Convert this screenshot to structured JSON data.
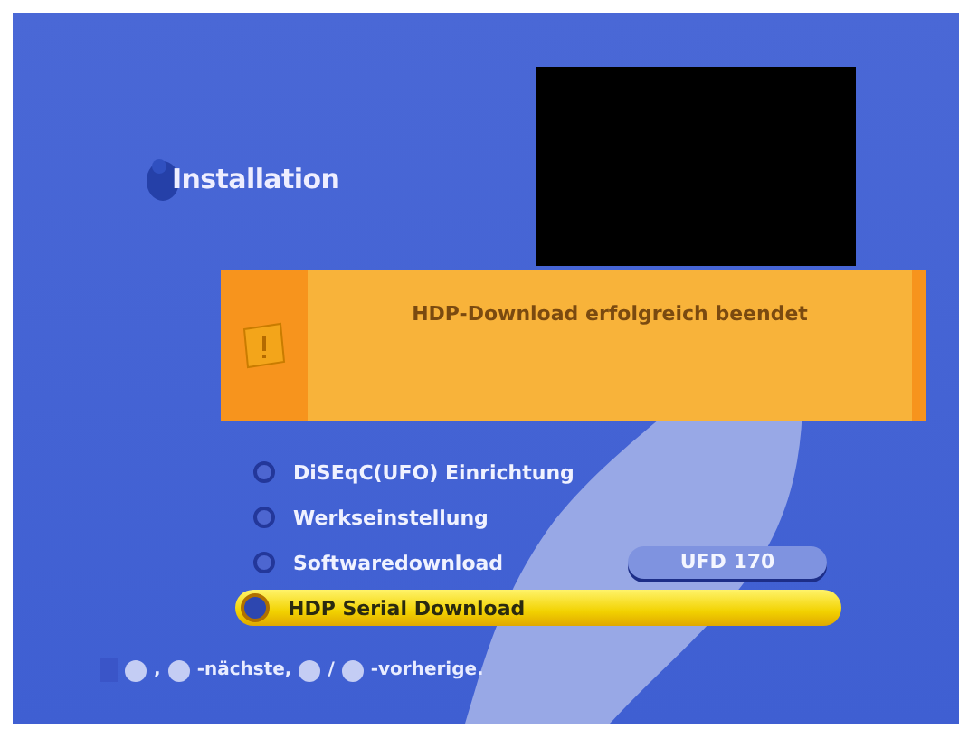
{
  "header": {
    "title": "Installation"
  },
  "dialog": {
    "message": "HDP-Download erfolgreich beendet"
  },
  "menu": [
    {
      "label": "DiSEqC(UFO) Einrichtung",
      "selected": false
    },
    {
      "label": "Werkseinstellung",
      "selected": false
    },
    {
      "label": "Softwaredownload",
      "selected": false,
      "value": "UFD 170"
    },
    {
      "label": "HDP Serial Download",
      "selected": true
    }
  ],
  "hint": [
    {
      "kind": "key"
    },
    {
      "kind": "text",
      "text": ","
    },
    {
      "kind": "key"
    },
    {
      "kind": "text",
      "text": "-nächste,"
    },
    {
      "kind": "key"
    },
    {
      "kind": "text",
      "text": "/"
    },
    {
      "kind": "key"
    },
    {
      "kind": "text",
      "text": "-vorherige."
    }
  ]
}
